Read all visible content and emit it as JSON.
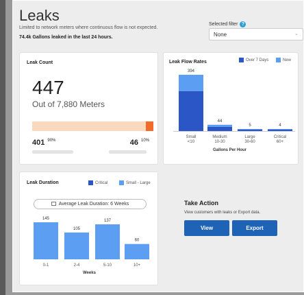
{
  "header": {
    "title": "Leaks",
    "subtitle": "Limited to network meters where continuous flow is not expected.",
    "summary": "74.4k Gallons leaked in the last 24 hours."
  },
  "filter": {
    "label": "Selected filter",
    "help_icon": "?",
    "value": "None"
  },
  "leak_count": {
    "title": "Leak Count",
    "total": "447",
    "out_of": "Out of 7,880 Meters",
    "left_value": "401",
    "left_pct": "90%",
    "right_value": "46",
    "right_pct": "10%",
    "fill_fraction": 0.1,
    "track_color": "#fbd9bf",
    "fill_color": "#f26b2a"
  },
  "flow_rates": {
    "title": "Leak Flow Rates",
    "legend": [
      {
        "label": "Over 7 Days",
        "color": "#2a56c6"
      },
      {
        "label": "New",
        "color": "#5c9ef2"
      }
    ],
    "axis_title": "Gallons Per Hour"
  },
  "duration": {
    "title": "Leak Duration",
    "legend": [
      {
        "label": "Critical",
        "color": "#2a56c6"
      },
      {
        "label": "Small - Large",
        "color": "#5c9ef2"
      }
    ],
    "average": "Average Leak Duration: 6 Weeks",
    "axis_title": "Weeks"
  },
  "take_action": {
    "title": "Take Action",
    "description": "View customers with leaks or Export data.",
    "view_label": "View",
    "export_label": "Export",
    "button_color": "#1e63b5"
  },
  "chart_data": [
    {
      "type": "bar",
      "title": "Leak Flow Rates",
      "xlabel": "Gallons Per Hour",
      "categories": [
        {
          "top": "Small",
          "bottom": "<10"
        },
        {
          "top": "Medium",
          "bottom": "10-30"
        },
        {
          "top": "Large",
          "bottom": "30-60"
        },
        {
          "top": "Critical",
          "bottom": "60+"
        }
      ],
      "totals": [
        394,
        44,
        5,
        4
      ],
      "series": [
        {
          "name": "Over 7 Days",
          "values": [
            280,
            30,
            3,
            3
          ]
        },
        {
          "name": "New",
          "values": [
            114,
            14,
            2,
            1
          ]
        }
      ],
      "ylim": [
        0,
        394
      ]
    },
    {
      "type": "bar",
      "title": "Leak Duration",
      "xlabel": "Weeks",
      "categories": [
        "0-1",
        "2-4",
        "5-10",
        "10+"
      ],
      "values": [
        145,
        105,
        137,
        60
      ],
      "ylim": [
        0,
        145
      ]
    }
  ]
}
